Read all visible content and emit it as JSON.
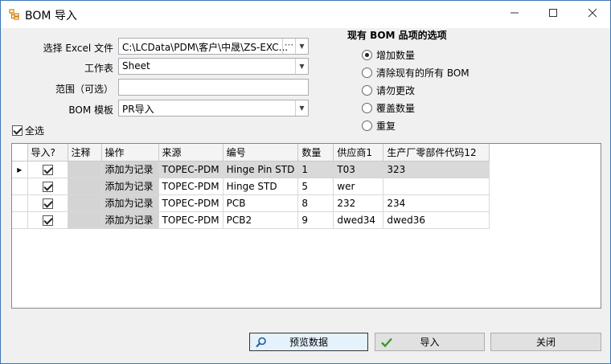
{
  "window": {
    "title": "BOM 导入",
    "minimize_icon": "minimize-icon",
    "maximize_icon": "maximize-icon",
    "close_icon": "close-icon"
  },
  "form": {
    "excel_file_label": "选择 Excel 文件",
    "excel_file_value": "C:\\LCData\\PDM\\客户\\中晟\\ZS-EXC...",
    "excel_browse_glyph": "···",
    "worksheet_label": "工作表",
    "worksheet_value": "Sheet",
    "range_label": "范围（可选）",
    "range_value": "",
    "template_label": "BOM 模板",
    "template_value": "PR导入",
    "select_all_label": "全选",
    "select_all_checked": true
  },
  "options": {
    "title": "现有 BOM 品项的选项",
    "items": [
      {
        "label": "增加数量",
        "selected": true
      },
      {
        "label": "清除现有的所有 BOM",
        "selected": false
      },
      {
        "label": "请勿更改",
        "selected": false
      },
      {
        "label": "覆盖数量",
        "selected": false
      },
      {
        "label": "重复",
        "selected": false
      }
    ]
  },
  "grid": {
    "columns": [
      "导入?",
      "注释",
      "操作",
      "来源",
      "编号",
      "数量",
      "供应商1",
      "生产厂零部件代码12"
    ],
    "rows": [
      {
        "import": true,
        "note": "",
        "action": "添加为记录",
        "source": "TOPEC-PDM",
        "number": "Hinge Pin STD",
        "qty": "1",
        "supplier": "T03",
        "part_code": "323"
      },
      {
        "import": true,
        "note": "",
        "action": "添加为记录",
        "source": "TOPEC-PDM",
        "number": "Hinge STD",
        "qty": "5",
        "supplier": "wer",
        "part_code": ""
      },
      {
        "import": true,
        "note": "",
        "action": "添加为记录",
        "source": "TOPEC-PDM",
        "number": "PCB",
        "qty": "8",
        "supplier": "232",
        "part_code": "234"
      },
      {
        "import": true,
        "note": "",
        "action": "添加为记录",
        "source": "TOPEC-PDM",
        "number": "PCB2",
        "qty": "9",
        "supplier": "dwed34",
        "part_code": "dwed36"
      }
    ],
    "current_row_glyph": "▸"
  },
  "buttons": {
    "preview_label": "预览数据",
    "import_label": "导入",
    "close_label": "关闭"
  },
  "colors": {
    "window_border": "#3c78b4",
    "check_green": "#3a9a2a",
    "accent_blue": "#1e5aa0"
  }
}
